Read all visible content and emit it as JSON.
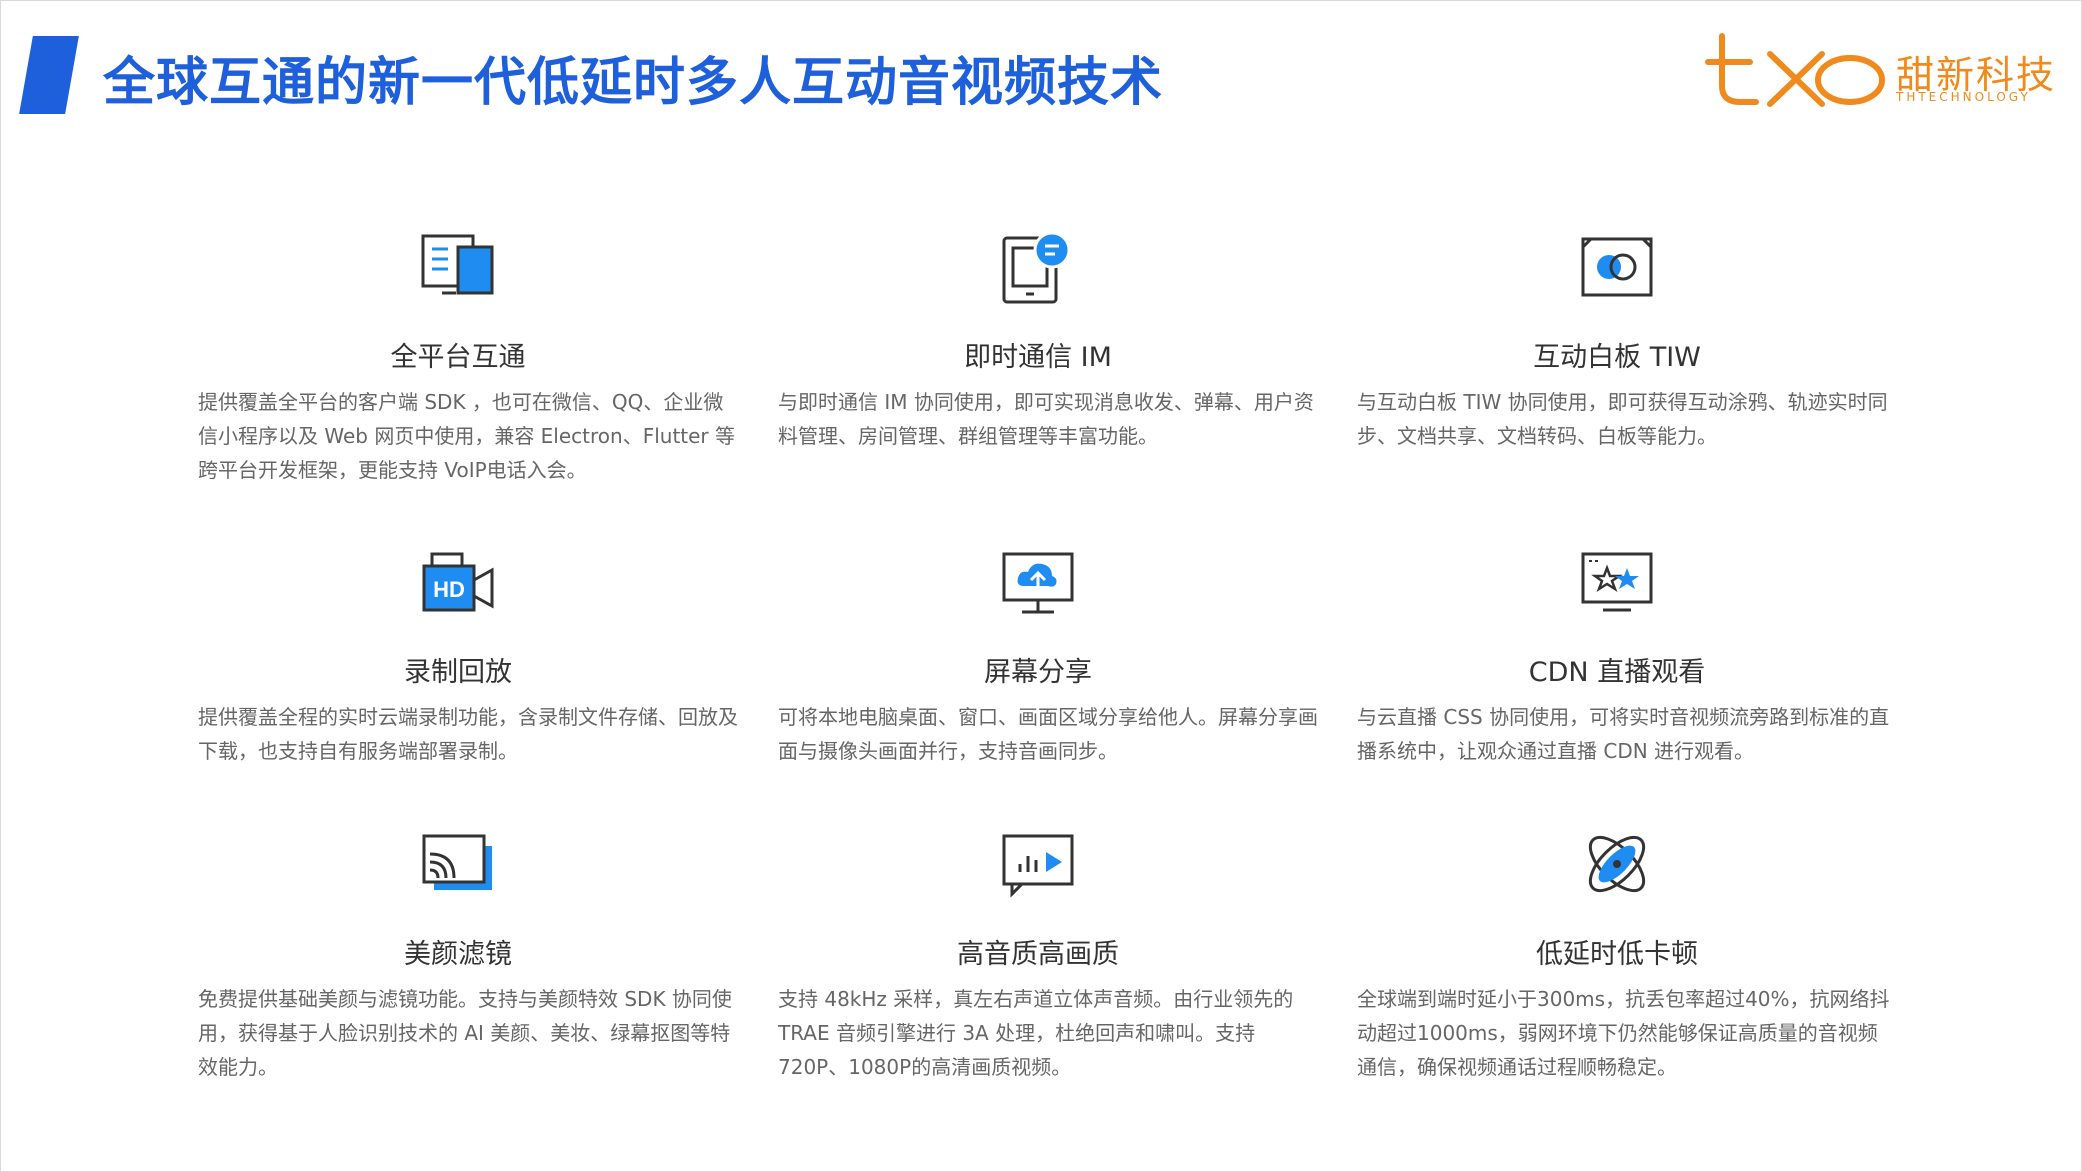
{
  "header": {
    "title": "全球互通的新一代低延时多人互动音视频技术",
    "accent_color": "#1e5fdc"
  },
  "logo": {
    "name_cn": "甜新科技",
    "name_en": "THTECHNOLOGY",
    "color": "#f08a1c"
  },
  "features": [
    {
      "icon": "devices-icon",
      "title": "全平台互通",
      "desc": "提供覆盖全平台的客户端 SDK ，也可在微信、QQ、企业微信小程序以及 Web 网页中使用，兼容 Electron、Flutter 等跨平台开发框架，更能支持 VoIP电话入会。"
    },
    {
      "icon": "chat-icon",
      "title": "即时通信 IM",
      "desc": "与即时通信 IM 协同使用，即可实现消息收发、弹幕、用户资料管理、房间管理、群组管理等丰富功能。"
    },
    {
      "icon": "whiteboard-icon",
      "title": "互动白板 TIW",
      "desc": "与互动白板 TIW 协同使用，即可获得互动涂鸦、轨迹实时同步、文档共享、文档转码、白板等能力。"
    },
    {
      "icon": "hd-camera-icon",
      "icon_text": "HD",
      "title": "录制回放",
      "desc": "提供覆盖全程的实时云端录制功能，含录制文件存储、回放及下载，也支持自有服务端部署录制。"
    },
    {
      "icon": "screen-share-icon",
      "title": "屏幕分享",
      "desc": "可将本地电脑桌面、窗口、画面区域分享给他人。屏幕分享画面与摄像头画面并行，支持音画同步。"
    },
    {
      "icon": "live-star-icon",
      "title": "CDN 直播观看",
      "desc": "与云直播 CSS 协同使用，可将实时音视频流旁路到标准的直播系统中，让观众通过直播 CDN 进行观看。"
    },
    {
      "icon": "beauty-filter-icon",
      "title": "美颜滤镜",
      "desc": "免费提供基础美颜与滤镜功能。支持与美颜特效 SDK 协同使用，获得基于人脸识别技术的 AI 美颜、美妆、绿幕抠图等特效能力。"
    },
    {
      "icon": "audio-video-icon",
      "title": "高音质高画质",
      "desc": "支持 48kHz 采样，真左右声道立体声音频。由行业领先的 TRAE 音频引擎进行 3A 处理，杜绝回声和啸叫。支持 720P、1080P的高清画质视频。"
    },
    {
      "icon": "orbit-icon",
      "title": "低延时低卡顿",
      "desc": "全球端到端时延小于300ms，抗丢包率超过40%，抗网络抖动超过1000ms，弱网环境下仍然能够保证高质量的音视频通信，确保视频通话过程顺畅稳定。"
    }
  ]
}
